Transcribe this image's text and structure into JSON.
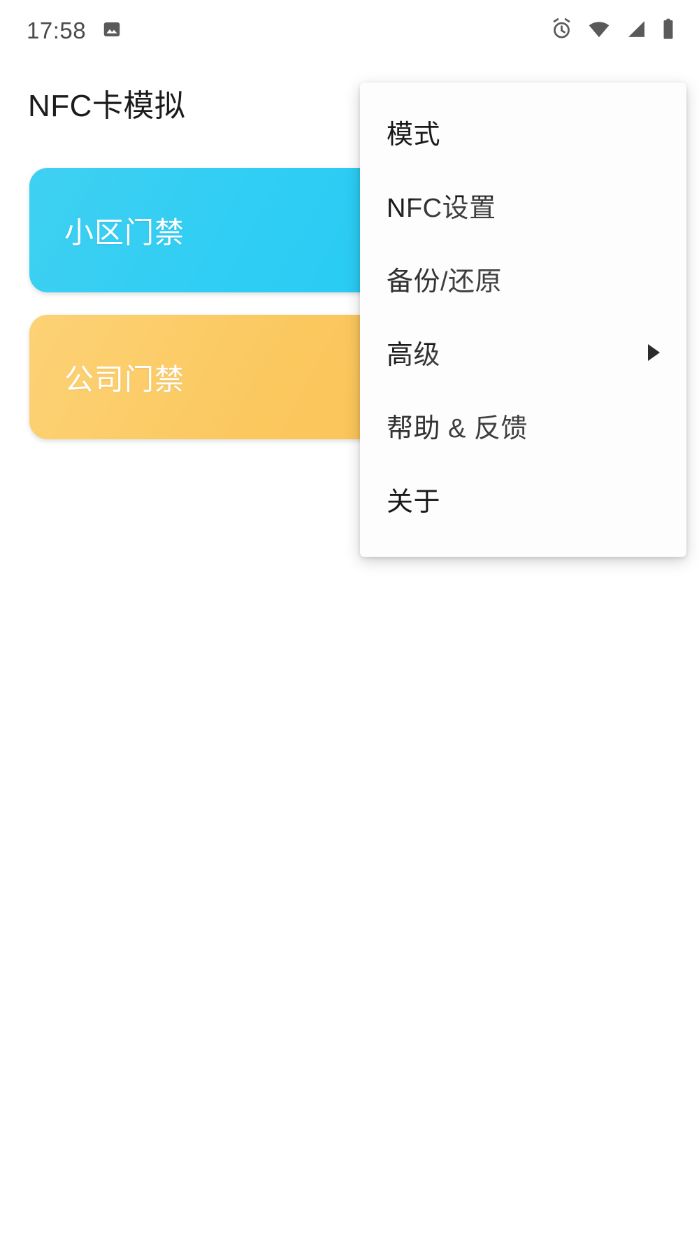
{
  "status_bar": {
    "clock": "17:58",
    "left_icons": [
      {
        "name": "photo-notification-icon",
        "glyph": "image"
      }
    ],
    "right_icons": [
      {
        "name": "alarm-clock-icon",
        "glyph": "alarm"
      },
      {
        "name": "wifi-icon",
        "glyph": "wifi"
      },
      {
        "name": "cellular-signal-icon",
        "glyph": "signal"
      },
      {
        "name": "battery-icon",
        "glyph": "battery"
      }
    ]
  },
  "header": {
    "title": "NFC卡模拟"
  },
  "cards": [
    {
      "label": "小区门禁",
      "color": "#2ecdf4"
    },
    {
      "label": "公司门禁",
      "color": "#fbc85f"
    }
  ],
  "menu": {
    "items": [
      {
        "label": "模式",
        "has_submenu": false
      },
      {
        "label": "NFC设置",
        "has_submenu": false
      },
      {
        "label": "备份/还原",
        "has_submenu": false
      },
      {
        "label": "高级",
        "has_submenu": true
      },
      {
        "label": "帮助 & 反馈",
        "has_submenu": false
      },
      {
        "label": "关于",
        "has_submenu": false
      }
    ]
  },
  "colors": {
    "background": "#ffffff",
    "text_primary": "#1a1a1a",
    "status_icon": "#5a5a5a",
    "card_blue": "#2ecdf4",
    "card_yellow": "#fbc85f",
    "menu_surface": "#fdfdfd"
  }
}
